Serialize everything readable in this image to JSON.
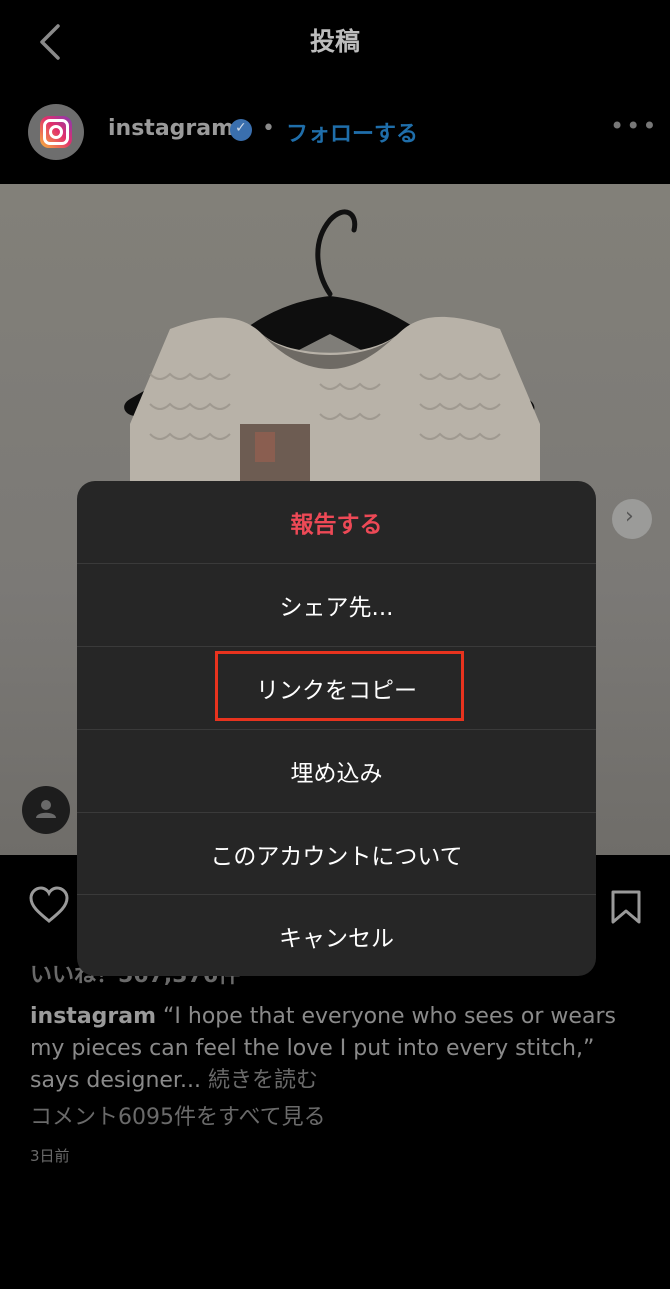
{
  "header": {
    "title": "投稿"
  },
  "profile": {
    "username": "instagram",
    "dot": "•",
    "follow_label": "フォローする",
    "more": "•••"
  },
  "post": {
    "likes_text": "いいね！567,376件",
    "caption_user": "instagram",
    "caption_text": " “I hope that everyone who sees or wears my pieces can feel the love I put into every stitch,” says designer...",
    "read_more": " 続きを読む",
    "view_comments": "コメント6095件をすべて見る",
    "timestamp": "3日前"
  },
  "menu": {
    "items": [
      {
        "label": "報告する"
      },
      {
        "label": "シェア先..."
      },
      {
        "label": "リンクをコピー"
      },
      {
        "label": "埋め込み"
      },
      {
        "label": "このアカウントについて"
      },
      {
        "label": "キャンセル"
      }
    ]
  },
  "colors": {
    "danger": "#ed4956",
    "link": "#1f6eaa",
    "highlight": "#e8331e",
    "sheet_bg": "#262626"
  }
}
